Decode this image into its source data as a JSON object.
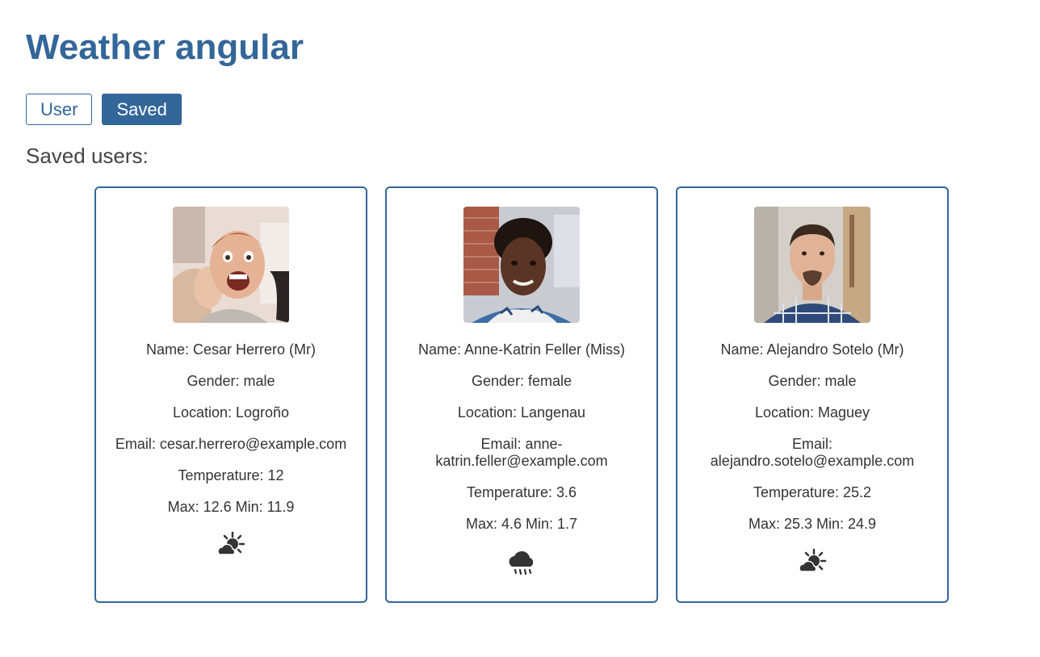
{
  "app": {
    "title": "Weather angular"
  },
  "tabs": [
    {
      "label": "User",
      "active": false
    },
    {
      "label": "Saved",
      "active": true
    }
  ],
  "saved_heading": "Saved users:",
  "colors": {
    "accent": "#336699",
    "text": "#333333"
  },
  "users": [
    {
      "name": "Name: Cesar Herrero (Mr)",
      "gender": "Gender: male",
      "location": "Location: Logroño",
      "email": "Email: cesar.herrero@example.com",
      "temperature": "Temperature: 12",
      "maxmin": "Max: 12.6 Min: 11.9",
      "weather_icon": "partly-cloudy-day-icon"
    },
    {
      "name": "Name: Anne-Katrin Feller (Miss)",
      "gender": "Gender: female",
      "location": "Location: Langenau",
      "email": "Email: anne-katrin.feller@example.com",
      "temperature": "Temperature: 3.6",
      "maxmin": "Max: 4.6 Min: 1.7",
      "weather_icon": "rain-cloud-icon"
    },
    {
      "name": "Name: Alejandro Sotelo (Mr)",
      "gender": "Gender: male",
      "location": "Location: Maguey",
      "email": "Email: alejandro.sotelo@example.com",
      "temperature": "Temperature: 25.2",
      "maxmin": "Max: 25.3 Min: 24.9",
      "weather_icon": "partly-cloudy-day-icon"
    }
  ]
}
